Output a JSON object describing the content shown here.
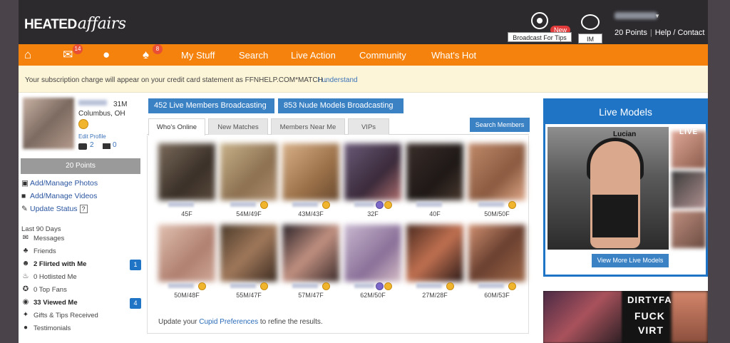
{
  "header": {
    "logo_bold": "HEATED",
    "logo_script": "affairs",
    "broadcast_label": "Broadcast For Tips",
    "broadcast_badge": "New",
    "im_label": "IM",
    "points": "20 Points",
    "help": "Help / Contact"
  },
  "nav": {
    "mail_count": "14",
    "notif_count": "8",
    "links": [
      "My Stuff",
      "Search",
      "Live Action",
      "Community",
      "What's Hot"
    ]
  },
  "notice": {
    "text": "Your subscription charge will appear on your credit card statement as FFNHELP.COM*MATCH .",
    "link": "I understand"
  },
  "profile": {
    "age_gender": "31M",
    "location": "Columbus, OH",
    "edit": "Edit Profile",
    "photos": "2",
    "videos": "0",
    "points": "20 Points"
  },
  "sidebar_links": [
    {
      "icon": "camera",
      "label": "Add/Manage Photos"
    },
    {
      "icon": "video",
      "label": "Add/Manage Videos"
    },
    {
      "icon": "pencil",
      "label": "Update Status",
      "help": "?"
    }
  ],
  "last90": {
    "title": "Last 90 Days",
    "items": [
      {
        "label": "Messages"
      },
      {
        "label": "Friends"
      },
      {
        "label": "2 Flirted with Me",
        "bold": true,
        "badge": "1"
      },
      {
        "label": "0 Hotlisted Me"
      },
      {
        "label": "0 Top Fans"
      },
      {
        "label": "33 Viewed Me",
        "bold": true,
        "badge": "4"
      },
      {
        "label": "Gifts & Tips Received"
      },
      {
        "label": "Testimonials"
      }
    ]
  },
  "center": {
    "live_members": "452 Live Members Broadcasting",
    "nude_models": "853 Nude Models Broadcasting",
    "tabs": [
      "Who's Online",
      "New Matches",
      "Members Near Me",
      "VIPs"
    ],
    "search_button": "Search Members",
    "members": [
      {
        "age": "45F"
      },
      {
        "age": "54M/49F"
      },
      {
        "age": "43M/43F"
      },
      {
        "age": "32F"
      },
      {
        "age": "40F"
      },
      {
        "age": "50M/50F"
      },
      {
        "age": "50M/48F"
      },
      {
        "age": "55M/47F"
      },
      {
        "age": "57M/47F"
      },
      {
        "age": "62M/50F"
      },
      {
        "age": "27M/28F"
      },
      {
        "age": "60M/53F"
      }
    ],
    "cupid_prefix": "Update your",
    "cupid_link": "Cupid Preferences",
    "cupid_suffix": "to refine the results."
  },
  "live_models": {
    "title": "Live Models",
    "model_name": "Lucian",
    "live_tag": "LIVE",
    "button": "View More Live Models"
  },
  "ad": {
    "line1": "DIRTYFA",
    "line2": "FUCK",
    "line3": "VIRT"
  },
  "colors": {
    "nav_orange": "#f4820c",
    "topbar_dark": "#2c2a2d",
    "button_blue": "#3b82c4",
    "badge_blue": "#1f74c6",
    "notice_bg": "#fdf5d8"
  }
}
